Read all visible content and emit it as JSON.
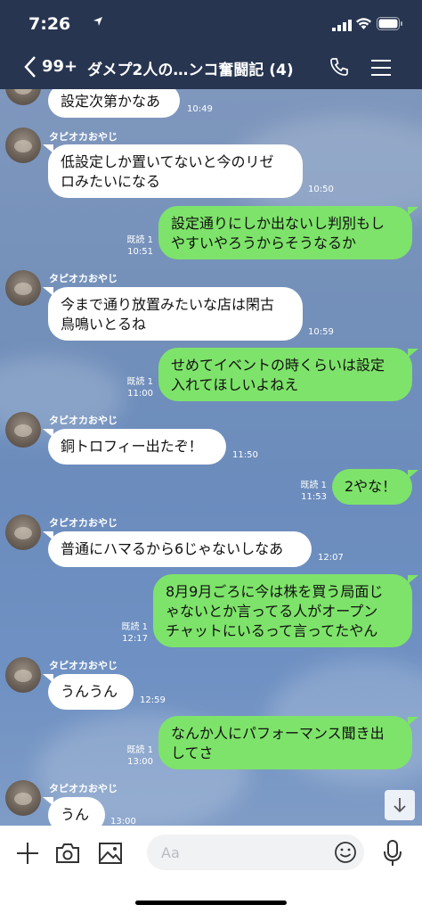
{
  "status": {
    "time": "7:26"
  },
  "header": {
    "unread": "99+",
    "title": "ダメプ2人の…ンコ奮闘記 (4)"
  },
  "sender_name": "タピオカおやじ",
  "read_label": "既読 1",
  "messages": [
    {
      "line1": "設定次第かなあ",
      "time": "10:49"
    },
    {
      "line1": "低設定しか置いてないと今のリゼ",
      "line2": "ロみたいになる",
      "time": "10:50"
    },
    {
      "line1": "設定通りにしか出ないし判別もし",
      "line2": "やすいやろうからそうなるか",
      "time": "10:51"
    },
    {
      "line1": "今まで通り放置みたいな店は閑古",
      "line2": "鳥鳴いとるね",
      "time": "10:59"
    },
    {
      "line1": "せめてイベントの時くらいは設定",
      "line2": "入れてほしいよねえ",
      "time": "11:00"
    },
    {
      "line1": "銅トロフィー出たぞ！",
      "time": "11:50"
    },
    {
      "line1": "2やな！",
      "time": "11:53"
    },
    {
      "line1": "普通にハマるから6じゃないしなあ",
      "time": "12:07"
    },
    {
      "line1": "8月9月ごろに今は株を買う局面じ",
      "line2": "ゃないとか言ってる人がオープン",
      "line3": "チャットにいるって言ってたやん",
      "time": "12:17"
    },
    {
      "line1": "うんうん",
      "time": "12:59"
    },
    {
      "line1": "なんか人にパフォーマンス聞き出",
      "line2": "してさ",
      "time": "13:00"
    },
    {
      "line1": "うん",
      "time": "13:00"
    }
  ],
  "composer": {
    "placeholder": "Aa"
  }
}
